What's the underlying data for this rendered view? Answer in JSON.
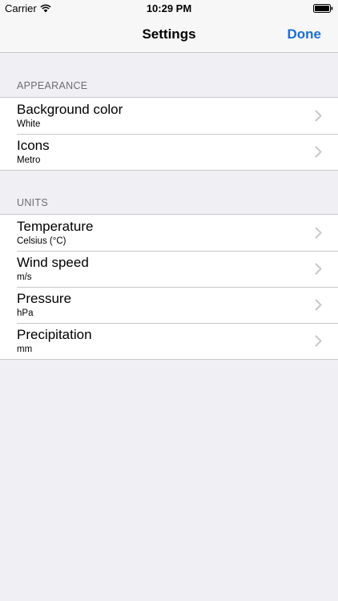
{
  "status_bar": {
    "carrier": "Carrier",
    "time": "10:29 PM",
    "icons": [
      "wifi-icon",
      "battery-icon"
    ]
  },
  "nav": {
    "title": "Settings",
    "done_label": "Done",
    "accent_color": "#1a6fd9"
  },
  "sections": [
    {
      "header": "APPEARANCE",
      "rows": [
        {
          "title": "Background color",
          "value": "White"
        },
        {
          "title": "Icons",
          "value": "Metro"
        }
      ]
    },
    {
      "header": "UNITS",
      "rows": [
        {
          "title": "Temperature",
          "value": "Celsius (°C)"
        },
        {
          "title": "Wind speed",
          "value": "m/s"
        },
        {
          "title": "Pressure",
          "value": "hPa"
        },
        {
          "title": "Precipitation",
          "value": "mm"
        }
      ]
    }
  ],
  "row_icon": "chevron-right-icon"
}
